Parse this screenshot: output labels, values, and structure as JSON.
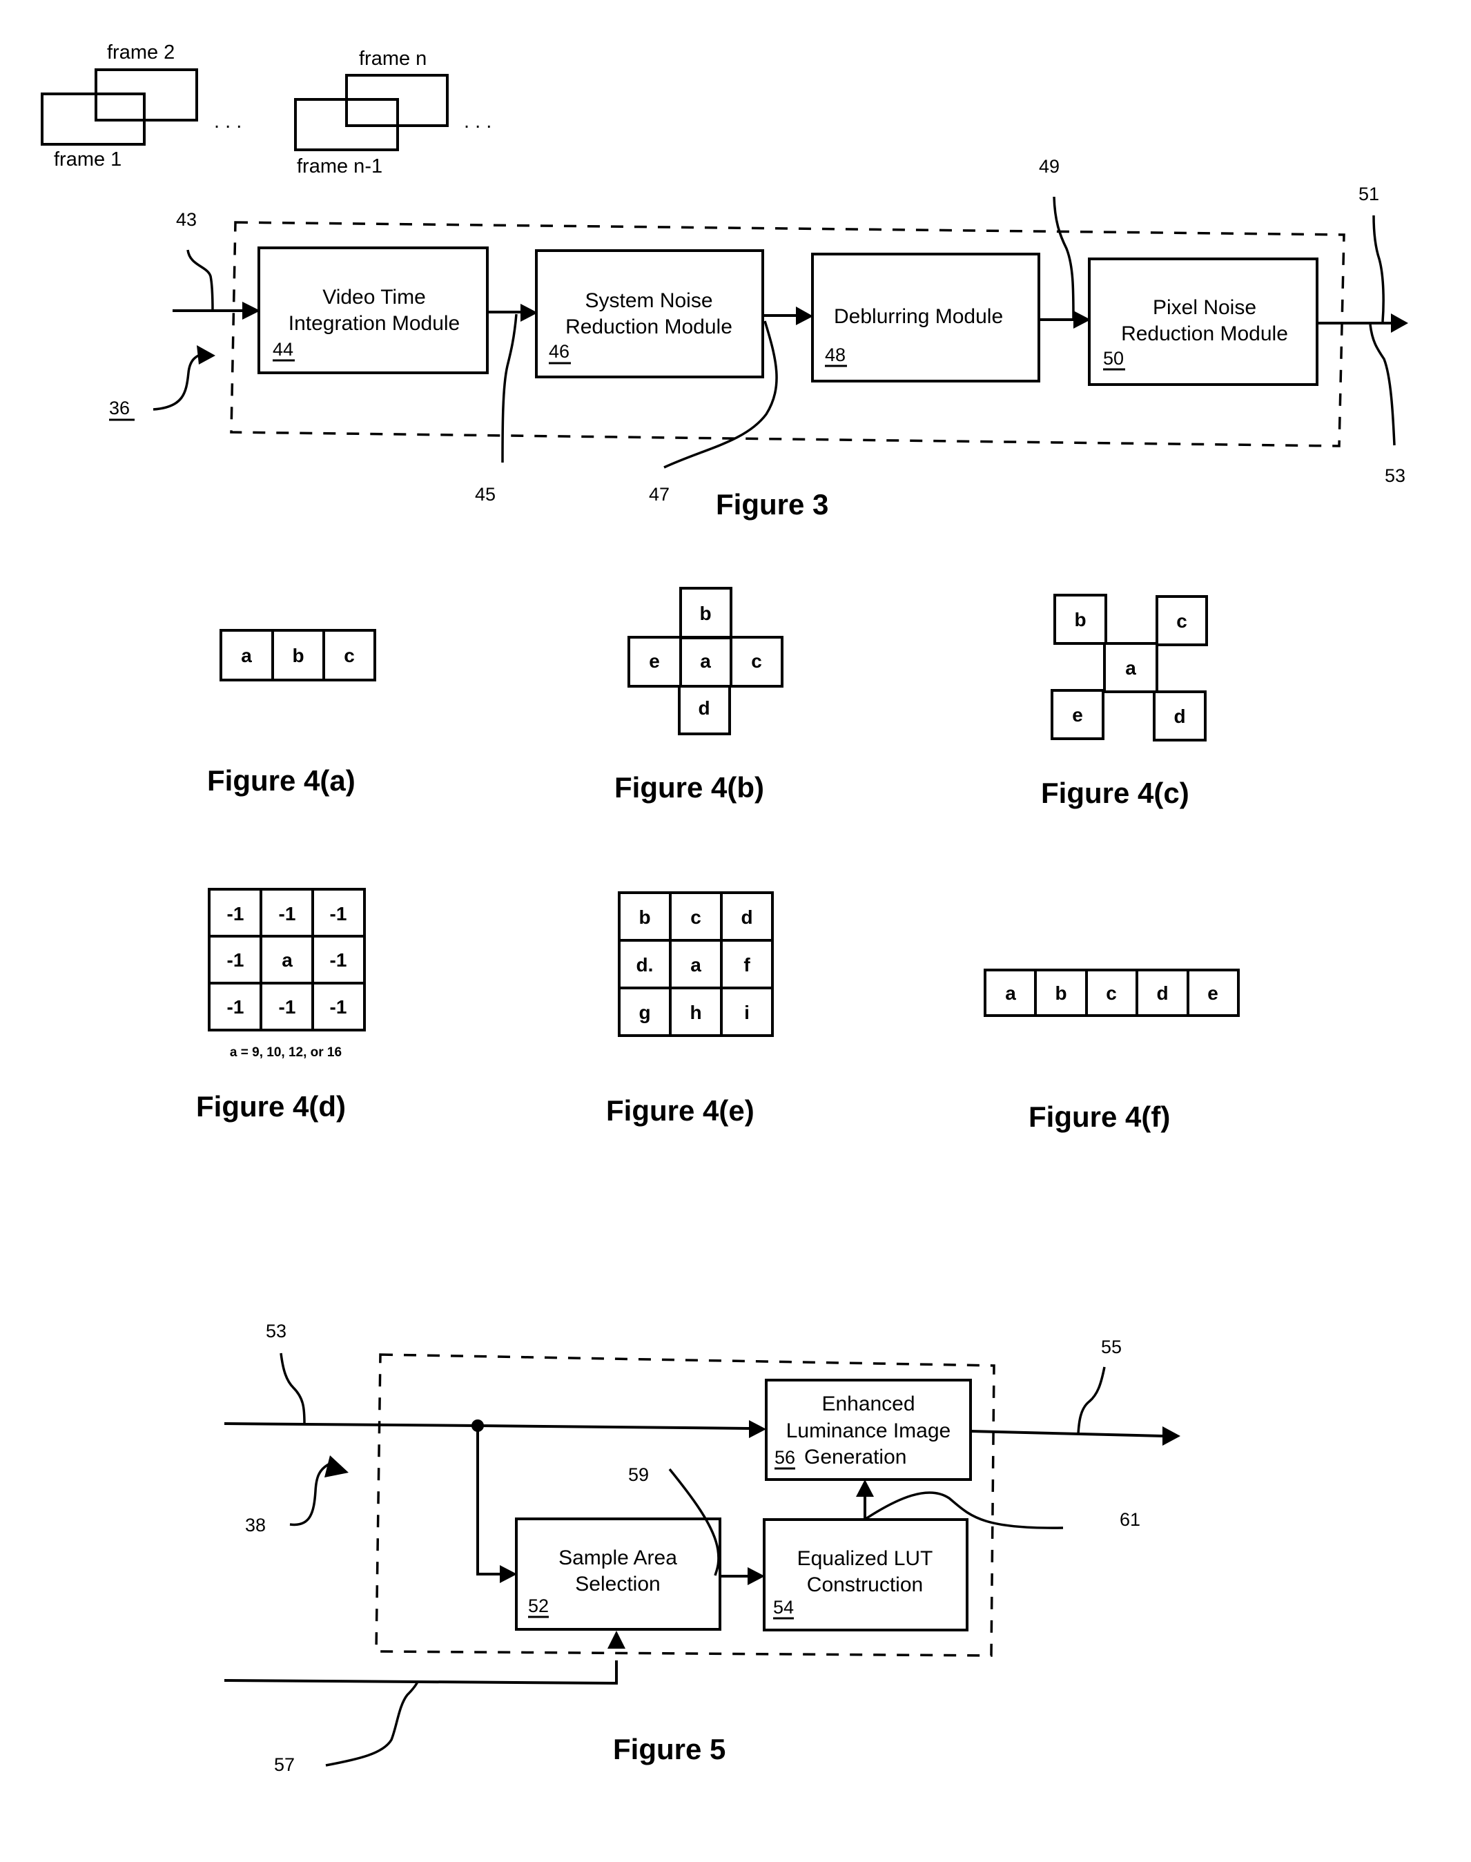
{
  "figure3": {
    "caption": "Figure 3",
    "frames": {
      "frame1": "frame 1",
      "frame2": "frame 2",
      "frame_n_minus_1": "frame n-1",
      "frame_n": "frame n",
      "ellipsis": ". . ."
    },
    "system_ref": "36",
    "refs": {
      "input": "43",
      "link_45": "45",
      "link_47": "47",
      "link_49": "49",
      "output_51": "51",
      "output_53": "53"
    },
    "modules": [
      {
        "line1": "Video Time",
        "line2": "Integration Module",
        "ref": "44"
      },
      {
        "line1": "System Noise",
        "line2": "Reduction Module",
        "ref": "46"
      },
      {
        "line1": "Deblurring Module",
        "line2": "",
        "ref": "48"
      },
      {
        "line1": "Pixel Noise",
        "line2": "Reduction Module",
        "ref": "50"
      }
    ]
  },
  "figure4": {
    "a": {
      "caption": "Figure 4(a)",
      "cells": [
        "a",
        "b",
        "c"
      ]
    },
    "b": {
      "caption": "Figure 4(b)",
      "top": "b",
      "left": "e",
      "center": "a",
      "right": "c",
      "bottom": "d"
    },
    "c": {
      "caption": "Figure 4(c)",
      "top_left": "b",
      "top_right": "c",
      "center": "a",
      "bottom_left": "e",
      "bottom_right": "d"
    },
    "d": {
      "caption": "Figure 4(d)",
      "grid": [
        [
          "-1",
          "-1",
          "-1"
        ],
        [
          "-1",
          "a",
          "-1"
        ],
        [
          "-1",
          "-1",
          "-1"
        ]
      ],
      "note": "a = 9, 10, 12, or 16"
    },
    "e": {
      "caption": "Figure 4(e)",
      "grid": [
        [
          "b",
          "c",
          "d"
        ],
        [
          "d.",
          "a",
          "f"
        ],
        [
          "g",
          "h",
          "i"
        ]
      ]
    },
    "f": {
      "caption": "Figure 4(f)",
      "cells": [
        "a",
        "b",
        "c",
        "d",
        "e"
      ]
    }
  },
  "figure5": {
    "caption": "Figure 5",
    "system_ref": "38",
    "refs": {
      "input_53": "53",
      "output_55": "55",
      "link_57": "57",
      "link_59": "59",
      "link_61": "61"
    },
    "modules": {
      "enhanced": {
        "line1": "Enhanced",
        "line2": "Luminance Image",
        "line3": "Generation",
        "ref": "56"
      },
      "sample": {
        "line1": "Sample Area",
        "line2": "Selection",
        "ref": "52"
      },
      "lut": {
        "line1": "Equalized LUT",
        "line2": "Construction",
        "ref": "54"
      }
    }
  }
}
